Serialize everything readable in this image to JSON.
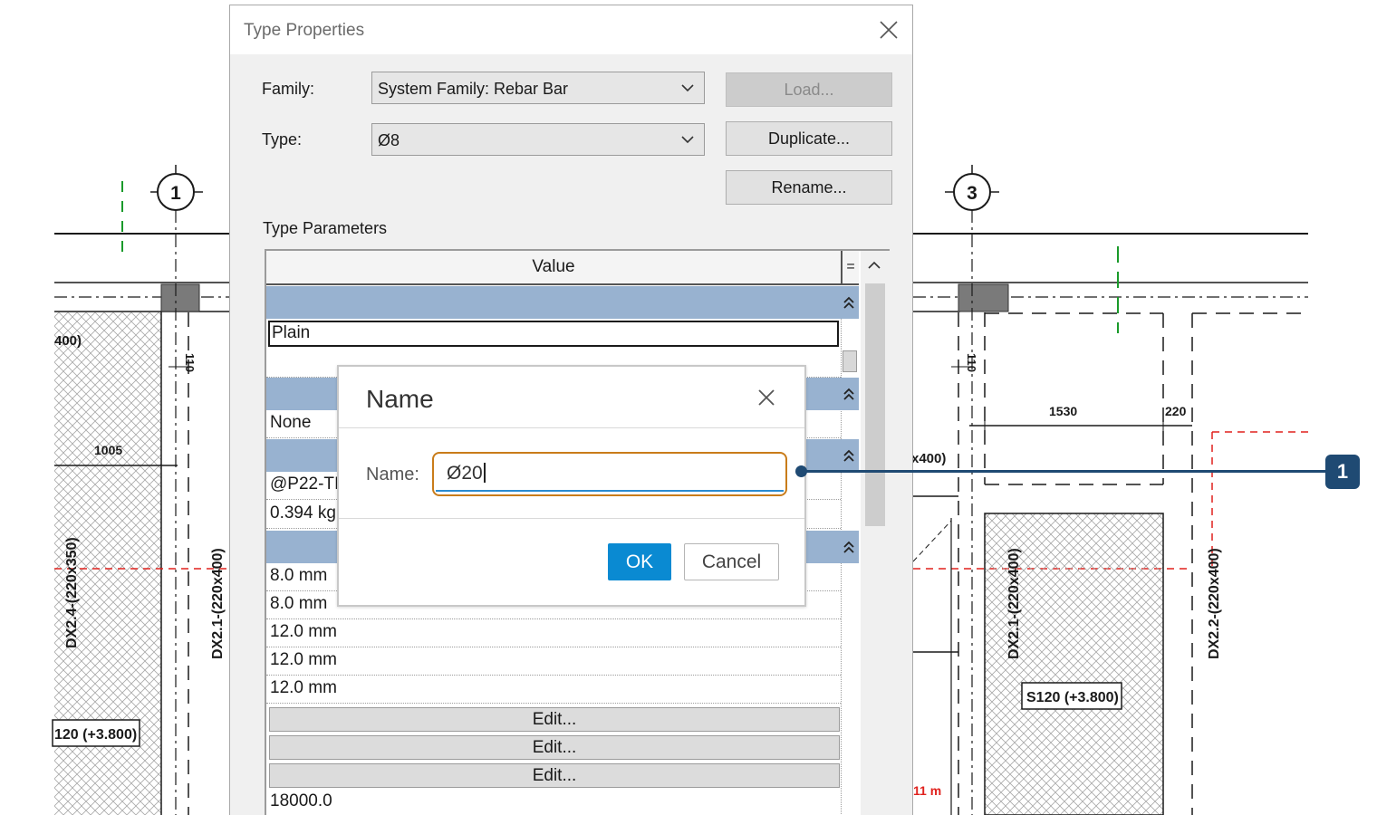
{
  "drawing": {
    "grid_bubbles": [
      "1",
      "3"
    ],
    "column_labels": [
      "DX2.4-(220x350)",
      "DX2.1-(220x400)",
      "DX2.1-(220x400)",
      "DX2.2-(220x400)"
    ],
    "dimension_labels": [
      "1005",
      "110",
      "110",
      "1530",
      "220"
    ],
    "partial_labels": [
      "400)",
      "x400)",
      "11 m"
    ],
    "slab_tags": [
      "120 (+3.800)",
      "S120 (+3.800)"
    ]
  },
  "type_properties": {
    "title": "Type Properties",
    "family_label": "Family:",
    "family_value": "System Family: Rebar Bar",
    "type_label": "Type:",
    "type_value": "Ø8",
    "load_button": "Load...",
    "duplicate_button": "Duplicate...",
    "rename_button": "Rename...",
    "section_label": "Type Parameters",
    "column_header": "Value",
    "equals_header": "=",
    "rows": {
      "plain": "Plain",
      "none": "None",
      "p22": "@P22-TI",
      "kg": "0.394 kg",
      "mm1": "8.0 mm",
      "mm2": "8.0 mm",
      "mm3": "12.0 mm",
      "mm4": "12.0 mm",
      "mm5": "12.0 mm",
      "edit1": "Edit...",
      "edit2": "Edit...",
      "edit3": "Edit...",
      "length": "18000.0"
    }
  },
  "name_dialog": {
    "title": "Name",
    "label": "Name:",
    "value": "Ø20",
    "ok": "OK",
    "cancel": "Cancel"
  },
  "callout": {
    "number": "1"
  },
  "colors": {
    "group_header": "#98b2d0",
    "ok_button": "#0a8ad2",
    "input_highlight": "#c97c1a",
    "callout": "#1f4a73",
    "red_dashes": "#e0211d",
    "green_dashes": "#1a9a2a"
  }
}
